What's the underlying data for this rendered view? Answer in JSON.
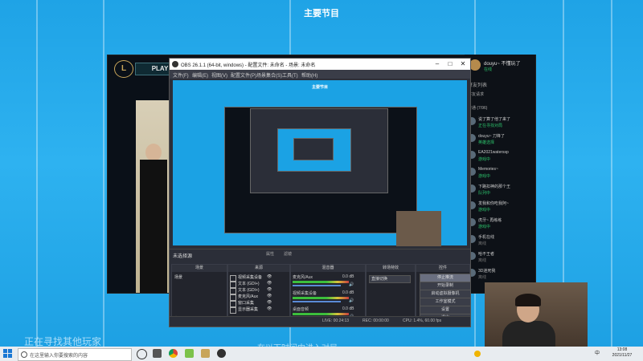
{
  "stream": {
    "title": "主要节目",
    "bottom_text": "正在寻找其他玩家",
    "bottom_text2": "在以下时间内进入对局"
  },
  "league": {
    "logo": "L",
    "play_label": "PLAY"
  },
  "friends": {
    "me_name": "douyu~ 不懂玩了",
    "me_status": "在线",
    "tab_label": "好友列表",
    "group1": "好友请求",
    "group2": "普通 (7/96)",
    "items": [
      {
        "name": "说了算了他了来了",
        "status": "正在寻找对局",
        "status_type": "green"
      },
      {
        "name": "douyu~ 刀锋了",
        "status": "英雄选择",
        "status_type": "green"
      },
      {
        "name": "EA2021waterssp",
        "status": "游戏中",
        "status_type": "green"
      },
      {
        "name": "Memories~",
        "status": "游戏中",
        "status_type": "green"
      },
      {
        "name": "下路扣神的那个王",
        "status": "队列中",
        "status_type": "green"
      },
      {
        "name": "发我和你吃我阿~",
        "status": "游戏中",
        "status_type": "green"
      },
      {
        "name": "虎牙~ 再练练",
        "status": "游戏中",
        "status_type": "green"
      },
      {
        "name": "手机在线",
        "status": "离线",
        "status_type": "gray"
      },
      {
        "name": "哈不王者",
        "status": "离线",
        "status_type": "gray"
      },
      {
        "name": "3D迷死我",
        "status": "离线",
        "status_type": "gray"
      }
    ]
  },
  "obs": {
    "title": "OBS 26.1.1 (64-bit, windows) - 配置文件: 未命名 - 场景: 未命名",
    "menu": [
      "文件(F)",
      "编辑(E)",
      "视图(V)",
      "配置文件(P)",
      "场景集合(S)",
      "工具(T)",
      "帮助(H)"
    ],
    "preview_title": "主要节目",
    "scene_name": "未选择源",
    "scene_bar_buttons": [
      "属性",
      "滤镜"
    ],
    "docks": {
      "scenes": "场景",
      "sources": "来源",
      "mixer": "混音器",
      "transitions": "转场特效",
      "controls": "控件"
    },
    "scene_item": "场景",
    "sources": [
      "视频采集设备",
      "文本 (GDI+)",
      "文本 (GDI+)",
      "麦克风/Aux",
      "窗口采集",
      "显示器采集"
    ],
    "mixer": [
      {
        "name": "麦克风/Aux",
        "value": "0.0 dB"
      },
      {
        "name": "视频采集设备",
        "value": "0.0 dB"
      },
      {
        "name": "桌面音频",
        "value": "0.0 dB"
      }
    ],
    "transition": "直接切换",
    "controls": [
      "停止推流",
      "开始录制",
      "启动虚拟摄像机",
      "工作室模式",
      "设置",
      "退出"
    ],
    "status": {
      "live": "LIVE: 00:24:13",
      "rec": "REC: 00:00:00",
      "cpu": "CPU: 1.4%, 60.00 fps"
    }
  },
  "taskbar": {
    "search_placeholder": "在这里输入你要搜索的内容",
    "time": "13:08",
    "date": "2021/11/27",
    "lang": "中"
  }
}
